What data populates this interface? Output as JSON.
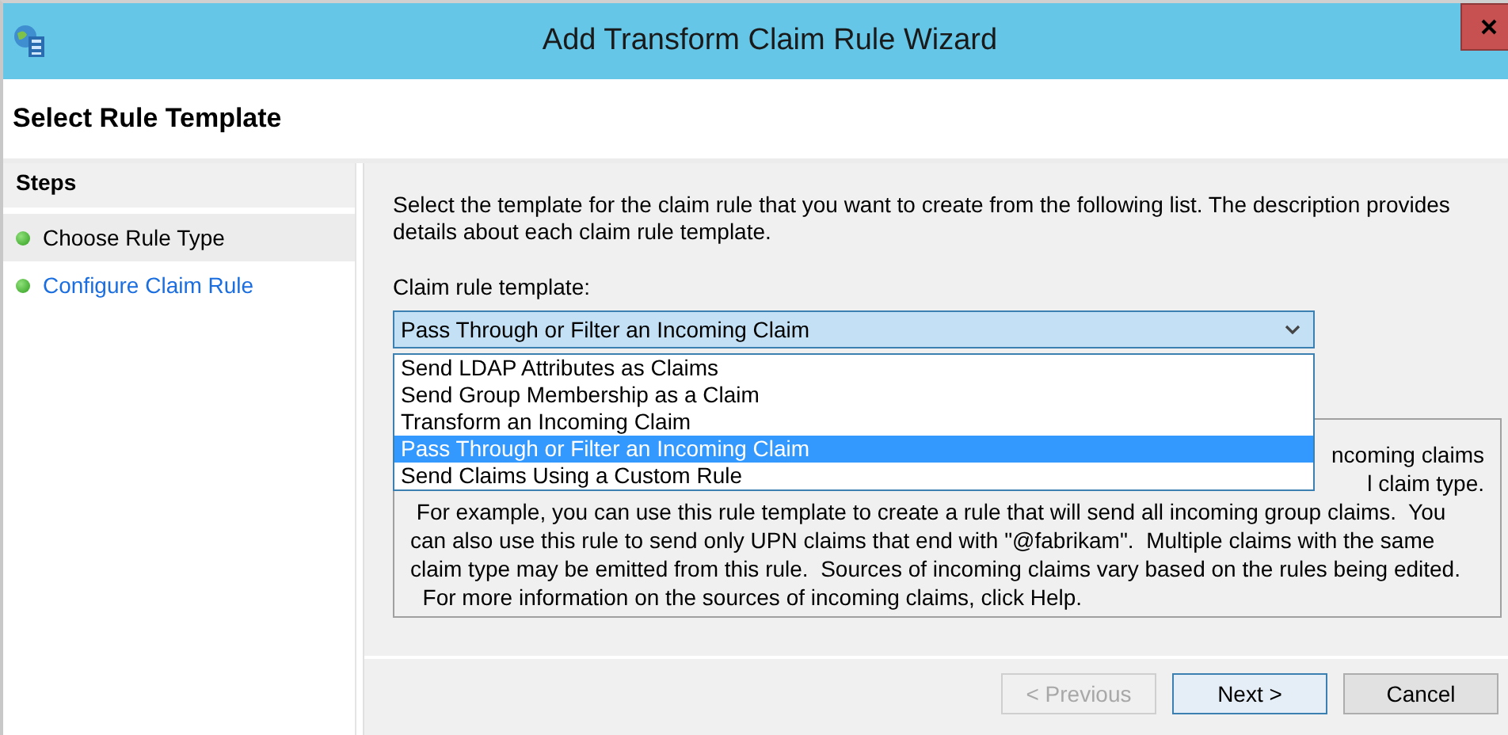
{
  "window": {
    "title": "Add Transform Claim Rule Wizard"
  },
  "page_title": "Select Rule Template",
  "steps": {
    "heading": "Steps",
    "items": [
      {
        "label": "Choose Rule Type",
        "selected": true
      },
      {
        "label": "Configure Claim Rule",
        "selected": false
      }
    ]
  },
  "intro_lines": [
    "Select the template for the claim rule that you want to create from the following list. The description provides",
    "details about each claim rule template."
  ],
  "template": {
    "label": "Claim rule template:",
    "value": "Pass Through or Filter an Incoming Claim",
    "expanded": true,
    "options": [
      {
        "label": "Send LDAP Attributes as Claims",
        "selected": false
      },
      {
        "label": "Send Group Membership as a Claim",
        "selected": false
      },
      {
        "label": "Transform an Incoming Claim",
        "selected": false
      },
      {
        "label": "Pass Through or Filter an Incoming Claim",
        "selected": true
      },
      {
        "label": "Send Claims Using a Custom Rule",
        "selected": false
      }
    ]
  },
  "description": {
    "partial_lines": [
      "ncoming claims",
      "l claim type."
    ],
    "lines": [
      " For example, you can use this rule template to create a rule that will send all incoming group claims.  You",
      "can also use this rule to send only UPN claims that end with \"@fabrikam\".  Multiple claims with the same",
      "claim type may be emitted from this rule.  Sources of incoming claims vary based on the rules being edited.",
      "  For more information on the sources of incoming claims, click Help."
    ]
  },
  "buttons": [
    {
      "kind": "back",
      "label": "< Previous",
      "disabled": true
    },
    {
      "kind": "next",
      "label": "Next >",
      "disabled": false
    },
    {
      "kind": "cancel",
      "label": "Cancel",
      "disabled": false
    }
  ]
}
